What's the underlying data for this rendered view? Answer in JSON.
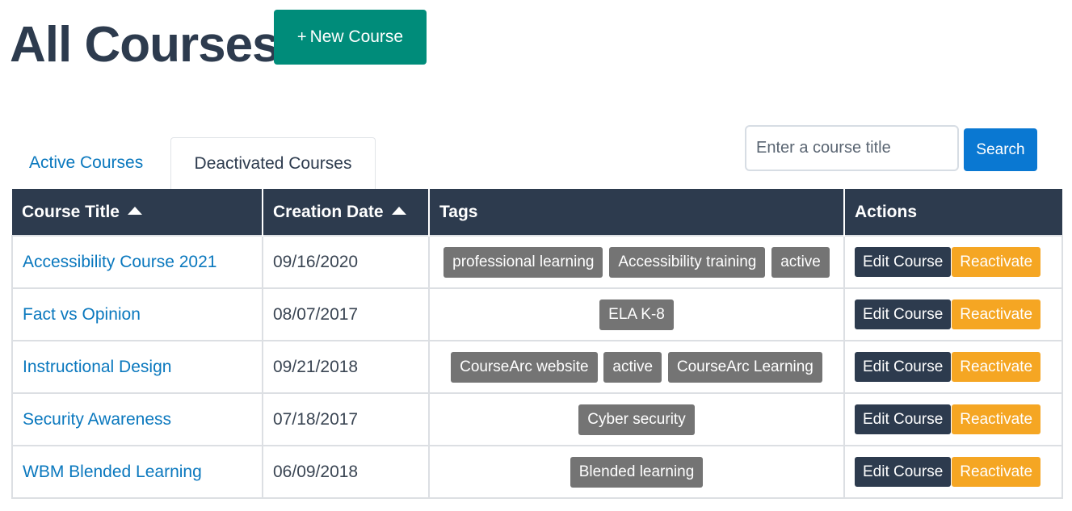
{
  "header": {
    "title": "All Courses",
    "new_course_label": "New Course",
    "new_course_icon": "+"
  },
  "tabs": [
    {
      "label": "Active Courses",
      "selected": false
    },
    {
      "label": "Deactivated Courses",
      "selected": true
    }
  ],
  "search": {
    "placeholder": "Enter a course title",
    "value": "",
    "button_label": "Search"
  },
  "table": {
    "columns": [
      {
        "label": "Course Title",
        "sortable": true
      },
      {
        "label": "Creation Date",
        "sortable": true
      },
      {
        "label": "Tags",
        "sortable": false
      },
      {
        "label": "Actions",
        "sortable": false
      }
    ],
    "edit_label": "Edit Course",
    "reactivate_label": "Reactivate",
    "rows": [
      {
        "title": "Accessibility Course 2021",
        "date": "09/16/2020",
        "tags": [
          "professional learning",
          "Accessibility training",
          "active"
        ]
      },
      {
        "title": "Fact vs Opinion",
        "date": "08/07/2017",
        "tags": [
          "ELA K-8"
        ]
      },
      {
        "title": "Instructional Design",
        "date": "09/21/2018",
        "tags": [
          "CourseArc website",
          "active",
          "CourseArc Learning"
        ]
      },
      {
        "title": "Security Awareness",
        "date": "07/18/2017",
        "tags": [
          "Cyber security"
        ]
      },
      {
        "title": "WBM Blended Learning",
        "date": "06/09/2018",
        "tags": [
          "Blended learning"
        ]
      }
    ]
  },
  "colors": {
    "navy": "#2d3b4e",
    "teal": "#008c7a",
    "link_blue": "#0a78be",
    "tag_gray": "#747474",
    "orange": "#f5a623"
  }
}
